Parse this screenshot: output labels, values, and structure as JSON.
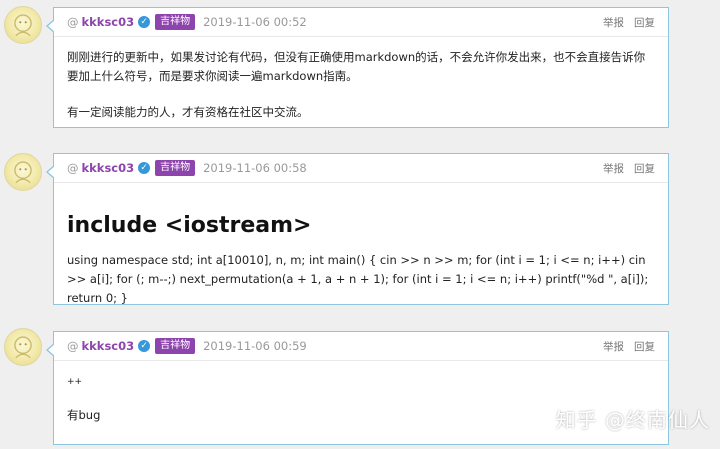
{
  "posts": [
    {
      "at": "@",
      "username": "kkksc03",
      "verified": "✓",
      "badge": "吉祥物",
      "timestamp": "2019-11-06 00:52",
      "report_label": "举报",
      "reply_label": "回复",
      "paragraphs": [
        "刚刚进行的更新中，如果发讨论有代码，但没有正确使用markdown的话，不会允许你发出来，也不会直接告诉你要加上什么符号，而是要求你阅读一遍markdown指南。",
        "有一定阅读能力的人，才有资格在社区中交流。"
      ]
    },
    {
      "at": "@",
      "username": "kkksc03",
      "verified": "✓",
      "badge": "吉祥物",
      "timestamp": "2019-11-06 00:58",
      "report_label": "举报",
      "reply_label": "回复",
      "heading": "include <iostream>",
      "code_text": "using namespace std; int a[10010], n, m; int main() { cin >> n >> m; for (int i = 1; i <= n; i++) cin >> a[i]; for (; m--;) next_permutation(a + 1, a + n + 1); for (int i = 1; i <= n; i++) printf(\"%d \", a[i]); return 0; }"
    },
    {
      "at": "@",
      "username": "kkksc03",
      "verified": "✓",
      "badge": "吉祥物",
      "timestamp": "2019-11-06 00:59",
      "report_label": "举报",
      "reply_label": "回复",
      "paragraphs": [
        "++",
        "有bug"
      ]
    }
  ],
  "watermark": "知乎 @终南仙人",
  "colors": {
    "accent_border": "#8fc6df",
    "username": "#8e44ad",
    "badge_bg": "#8e44ad",
    "verified": "#3498db"
  }
}
